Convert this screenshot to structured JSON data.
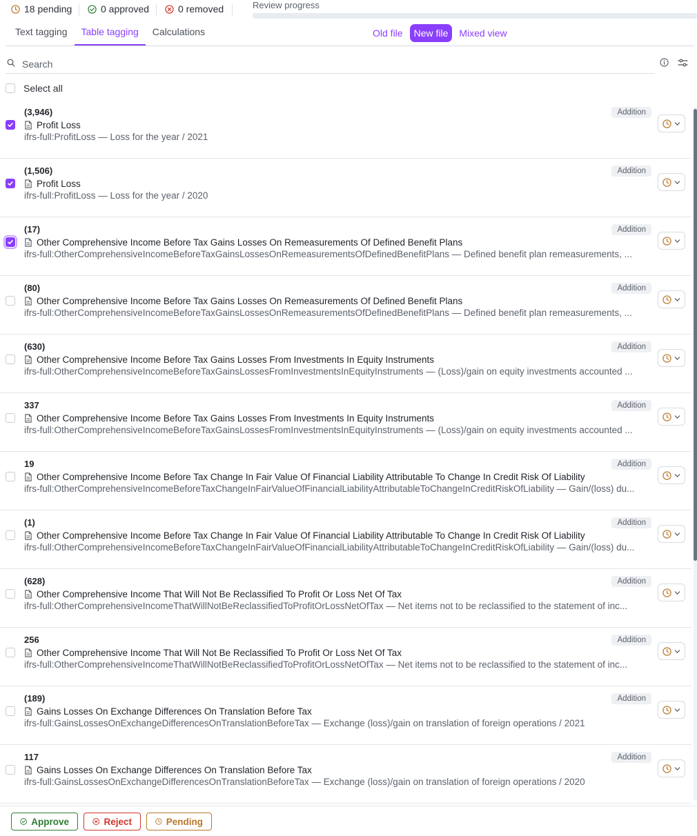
{
  "header": {
    "pending_count": "18 pending",
    "approved_count": "0 approved",
    "removed_count": "0 removed",
    "progress_label": "Review progress",
    "progress_fraction": 0.0
  },
  "tabs": [
    {
      "label": "Text tagging",
      "active": false
    },
    {
      "label": "Table tagging",
      "active": true
    },
    {
      "label": "Calculations",
      "active": false
    }
  ],
  "view_modes": [
    {
      "label": "Old file",
      "active": false
    },
    {
      "label": "New file",
      "active": true
    },
    {
      "label": "Mixed view",
      "active": false
    }
  ],
  "search": {
    "placeholder": "Search",
    "value": ""
  },
  "select_all_label": "Select all",
  "items": [
    {
      "value": "(3,946)",
      "title": "Profit Loss",
      "concept": "ifrs-full:ProfitLoss — Loss for the year / 2021",
      "badge": "Addition",
      "checked": true
    },
    {
      "value": "(1,506)",
      "title": "Profit Loss",
      "concept": "ifrs-full:ProfitLoss — Loss for the year / 2020",
      "badge": "Addition",
      "checked": true
    },
    {
      "value": "(17)",
      "title": "Other Comprehensive Income Before Tax Gains Losses On Remeasurements Of Defined Benefit Plans",
      "concept": "ifrs-full:OtherComprehensiveIncomeBeforeTaxGainsLossesOnRemeasurementsOfDefinedBenefitPlans — Defined benefit plan remeasurements, ...",
      "badge": "Addition",
      "checked": true
    },
    {
      "value": "(80)",
      "title": "Other Comprehensive Income Before Tax Gains Losses On Remeasurements Of Defined Benefit Plans",
      "concept": "ifrs-full:OtherComprehensiveIncomeBeforeTaxGainsLossesOnRemeasurementsOfDefinedBenefitPlans — Defined benefit plan remeasurements, ...",
      "badge": "Addition",
      "checked": false
    },
    {
      "value": "(630)",
      "title": "Other Comprehensive Income Before Tax Gains Losses From Investments In Equity Instruments",
      "concept": "ifrs-full:OtherComprehensiveIncomeBeforeTaxGainsLossesFromInvestmentsInEquityInstruments — (Loss)/gain on equity investments accounted ...",
      "badge": "Addition",
      "checked": false
    },
    {
      "value": "337",
      "title": "Other Comprehensive Income Before Tax Gains Losses From Investments In Equity Instruments",
      "concept": "ifrs-full:OtherComprehensiveIncomeBeforeTaxGainsLossesFromInvestmentsInEquityInstruments — (Loss)/gain on equity investments accounted ...",
      "badge": "Addition",
      "checked": false
    },
    {
      "value": "19",
      "title": "Other Comprehensive Income Before Tax Change In Fair Value Of Financial Liability Attributable To Change In Credit Risk Of Liability",
      "concept": "ifrs-full:OtherComprehensiveIncomeBeforeTaxChangeInFairValueOfFinancialLiabilityAttributableToChangeInCreditRiskOfLiability — Gain/(loss) du...",
      "badge": "Addition",
      "checked": false
    },
    {
      "value": "(1)",
      "title": "Other Comprehensive Income Before Tax Change In Fair Value Of Financial Liability Attributable To Change In Credit Risk Of Liability",
      "concept": "ifrs-full:OtherComprehensiveIncomeBeforeTaxChangeInFairValueOfFinancialLiabilityAttributableToChangeInCreditRiskOfLiability — Gain/(loss) du...",
      "badge": "Addition",
      "checked": false
    },
    {
      "value": "(628)",
      "title": "Other Comprehensive Income That Will Not Be Reclassified To Profit Or Loss Net Of Tax",
      "concept": "ifrs-full:OtherComprehensiveIncomeThatWillNotBeReclassifiedToProfitOrLossNetOfTax — Net items not to be reclassified to the statement of inc...",
      "badge": "Addition",
      "checked": false
    },
    {
      "value": "256",
      "title": "Other Comprehensive Income That Will Not Be Reclassified To Profit Or Loss Net Of Tax",
      "concept": "ifrs-full:OtherComprehensiveIncomeThatWillNotBeReclassifiedToProfitOrLossNetOfTax — Net items not to be reclassified to the statement of inc...",
      "badge": "Addition",
      "checked": false
    },
    {
      "value": "(189)",
      "title": "Gains Losses On Exchange Differences On Translation Before Tax",
      "concept": "ifrs-full:GainsLossesOnExchangeDifferencesOnTranslationBeforeTax — Exchange (loss)/gain on translation of foreign operations / 2021",
      "badge": "Addition",
      "checked": false
    },
    {
      "value": "117",
      "title": "Gains Losses On Exchange Differences On Translation Before Tax",
      "concept": "ifrs-full:GainsLossesOnExchangeDifferencesOnTranslationBeforeTax — Exchange (loss)/gain on translation of foreign operations / 2020",
      "badge": "Addition",
      "checked": false
    }
  ],
  "actions": {
    "approve": "Approve",
    "reject": "Reject",
    "pending": "Pending"
  },
  "colors": {
    "accent": "#8a3ffc",
    "approve": "#2e7d32",
    "reject": "#d0352b",
    "pending": "#b8772a"
  },
  "icons": {
    "pending": "clock-icon",
    "approved": "check-circle-icon",
    "removed": "x-circle-icon",
    "search": "search-icon",
    "info": "info-icon",
    "filter": "sliders-icon",
    "document": "document-icon",
    "status": "clock-icon",
    "chevron": "chevron-down-icon"
  }
}
